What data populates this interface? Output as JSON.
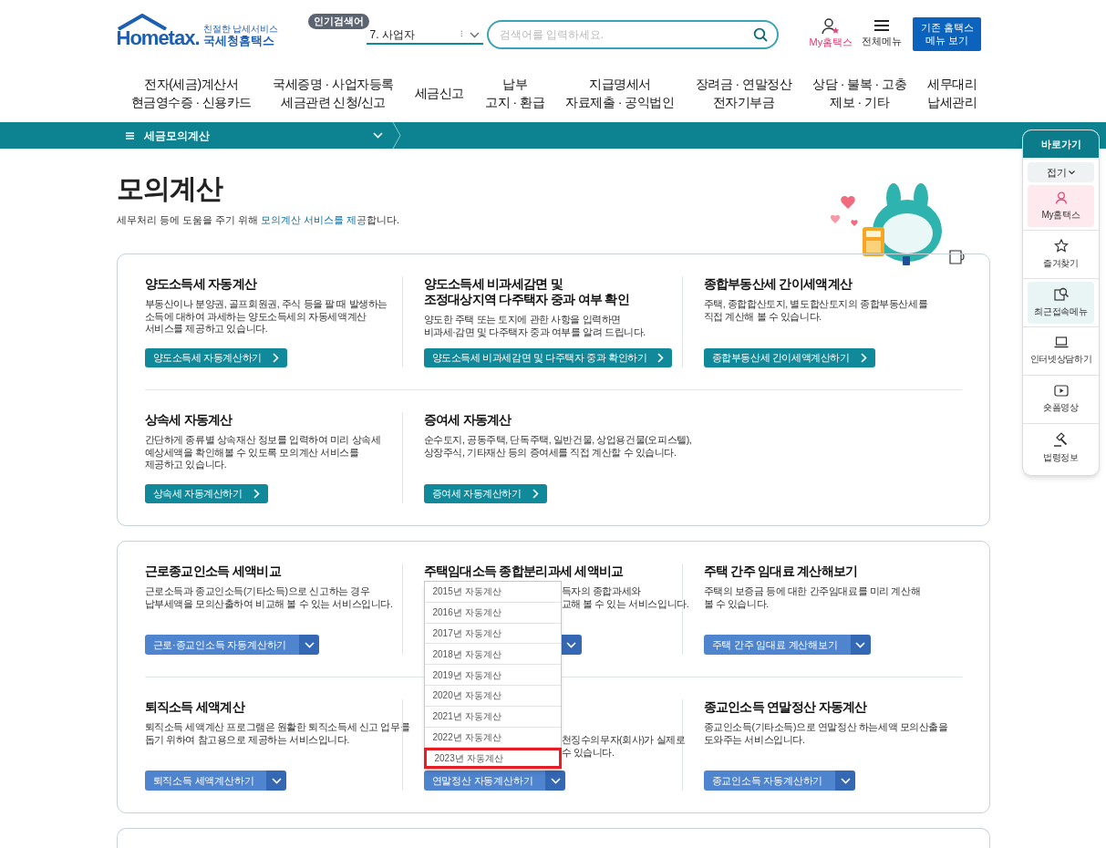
{
  "header": {
    "logo_tagline": "친절한 납세서비스",
    "logo_mark": "Hometax.",
    "logo_name": "국세청홈택스",
    "popular_badge": "인기검색어",
    "popular_keyword": "7.  사업자",
    "popular_pager": "⁝",
    "search": {
      "placeholder": "검색어를 입력하세요."
    },
    "my_label": "My홈택스",
    "menu_label": "전체메뉴",
    "legacy_button": [
      "기존 홈택스",
      "메뉴 보기"
    ]
  },
  "nav": [
    {
      "lines": [
        "전자(세금)계산서",
        "현금영수증 · 신용카드"
      ]
    },
    {
      "lines": [
        "국세증명 · 사업자등록",
        "세금관련 신청/신고"
      ]
    },
    {
      "lines": [
        "세금신고"
      ]
    },
    {
      "lines": [
        "납부",
        "고지 · 환급"
      ]
    },
    {
      "lines": [
        "지급명세서",
        "자료제출 · 공익법인"
      ]
    },
    {
      "lines": [
        "장려금 · 연말정산",
        "전자기부금"
      ]
    },
    {
      "lines": [
        "상담 · 불복 · 고충",
        "제보 · 기타"
      ]
    },
    {
      "lines": [
        "세무대리",
        "납세관리"
      ]
    }
  ],
  "breadcrumb": {
    "label": "세금모의계산"
  },
  "page": {
    "title": "모의계산",
    "intro": [
      {
        "text": "세무처리 등에 도움을 주기 위해 ",
        "highlight": false
      },
      {
        "text": "모의계산 서비스를 제공",
        "highlight": true
      },
      {
        "text": "합니다.",
        "highlight": false
      }
    ]
  },
  "sections": [
    {
      "rows": [
        [
          {
            "title": [
              "양도소득세 자동계산"
            ],
            "desc": [
              "부동산이나 분양권, 골프회원권, 주식 등을 팔 때 발생하는",
              "소득에 대하여 과세하는 양도소득세의 자동세액계산",
              "서비스를 제공하고 있습니다."
            ],
            "button": {
              "kind": "link",
              "label": "양도소득세 자동계산하기"
            }
          },
          {
            "title": [
              "양도소득세 비과세감면 및",
              "조정대상지역 다주택자 중과 여부 확인"
            ],
            "desc": [
              "양도한 주택 또는 토지에 관한 사항을 입력하면",
              "비과세·감면 및 다주택자 중과 여부를 알려 드립니다."
            ],
            "button": {
              "kind": "link",
              "label": "양도소득세 비과세감면 및 다주택자 중과 확인하기"
            }
          },
          {
            "title": [
              "종합부동산세 간이세액계산"
            ],
            "desc": [
              "주택, 종합합산토지, 별도합산토지의 종합부동산세를",
              "직접 계산해 볼 수 있습니다."
            ],
            "button": {
              "kind": "link",
              "label": "종합부동산세 간이세액계산하기"
            }
          }
        ],
        [
          {
            "title": [
              "상속세 자동계산"
            ],
            "desc": [
              "간단하게 종류별 상속재산 정보를 입력하여 미리 상속세",
              "예상세액을 확인해볼 수 있도록 모의계산 서비스를",
              "제공하고 있습니다."
            ],
            "button": {
              "kind": "link",
              "label": "상속세 자동계산하기"
            }
          },
          {
            "title": [
              "증여세 자동계산"
            ],
            "desc": [
              "순수토지, 공동주택, 단독주택, 일반건물, 상업용건물(오피스텔),",
              "상장주식, 기타재산 등의 증여세를 직접 계산할 수 있습니다."
            ],
            "button": {
              "kind": "link",
              "label": "증여세 자동계산하기"
            }
          }
        ]
      ]
    },
    {
      "rows": [
        [
          {
            "title": [
              "근로종교인소득 세액비교"
            ],
            "desc": [
              "근로소득과 종교인소득(기타소득)으로 신고하는 경우",
              "납부세액을 모의산출하여 비교해 볼 수 있는 서비스입니다."
            ],
            "button": {
              "kind": "split",
              "label": "근로·종교인소득 자동계산하기"
            }
          },
          {
            "title": [
              "주택임대소득 종합분리과세 세액비교"
            ],
            "covered": true,
            "desc": [
              "득자의 종합과세와",
              "교해 볼 수 있는 서비스입니다."
            ],
            "button": {
              "kind": "split"
            }
          },
          {
            "title": [
              "주택 간주 임대료 계산해보기"
            ],
            "desc": [
              "주택의 보증금 등에 대한 간주임대료를 미리 계산해",
              "볼 수 있습니다."
            ],
            "button": {
              "kind": "split",
              "label": "주택 간주 임대료 계산해보기"
            }
          }
        ],
        [
          {
            "title": [
              "퇴직소득 세액계산"
            ],
            "desc": [
              "퇴직소득 세액계산 프로그램은 원활한 퇴직소득세 신고 업무를",
              "돕기 위하여 참고용으로 제공하는 서비스입니다."
            ],
            "button": {
              "kind": "split",
              "label": "퇴직소득 세액계산하기"
            }
          },
          {
            "covered": true,
            "desc": [
              "천징수의무자(회사)가 실제로",
              "수 있습니다."
            ],
            "button": {
              "kind": "split",
              "label": "연말정산 자동계산하기"
            }
          },
          {
            "title": [
              "종교인소득 연말정산 자동계산"
            ],
            "desc": [
              "종교인소득(기타소득)으로 연말정산 하는세액 모의산출을",
              "도와주는 서비스입니다."
            ],
            "button": {
              "kind": "split",
              "label": "종교인소득 자동계산하기"
            }
          }
        ]
      ],
      "dropdown": {
        "items": [
          {
            "label": "2015년 자동계산",
            "selected": false
          },
          {
            "label": "2016년 자동계산",
            "selected": false
          },
          {
            "label": "2017년 자동계산",
            "selected": false
          },
          {
            "label": "2018년 자동계산",
            "selected": false
          },
          {
            "label": "2019년 자동계산",
            "selected": false
          },
          {
            "label": "2020년 자동계산",
            "selected": false
          },
          {
            "label": "2021년 자동계산",
            "selected": false
          },
          {
            "label": "2022년 자동계산",
            "selected": false
          },
          {
            "label": "2023년 자동계산",
            "selected": true
          }
        ]
      }
    },
    {
      "kind": "partial"
    }
  ],
  "quickbar": {
    "title": "바로가기",
    "fold": "접기",
    "items": [
      {
        "label": "My홈택스",
        "color": "#fde9ee"
      },
      {
        "label": "즐겨찾기"
      },
      {
        "label": "최근접속메뉴",
        "color": "#e9f5f5"
      },
      {
        "label": "인터넷상담하기"
      },
      {
        "label": "숏폼영상"
      },
      {
        "label": "법령정보"
      }
    ]
  }
}
